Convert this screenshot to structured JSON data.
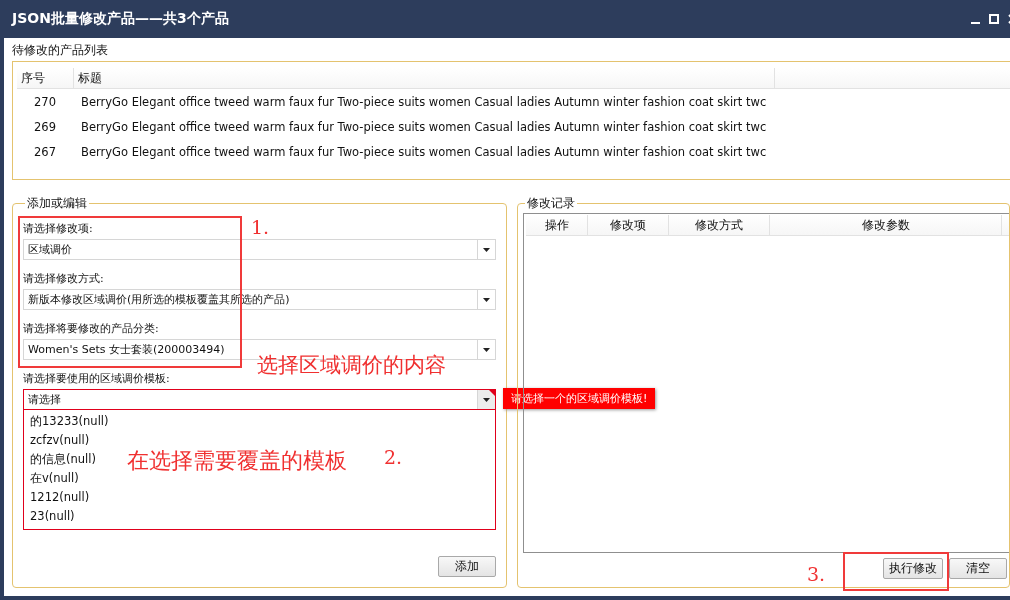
{
  "window": {
    "title": "JSON批量修改产品——共3个产品"
  },
  "product_list": {
    "label": "待修改的产品列表",
    "columns": [
      "序号",
      "标题"
    ],
    "rows": [
      {
        "index": "270",
        "title": "BerryGo Elegant office tweed warm faux fur Two-piece suits women Casual ladies Autumn winter fashion coat skirt twc"
      },
      {
        "index": "269",
        "title": "BerryGo Elegant office tweed warm faux fur Two-piece suits women Casual ladies Autumn winter fashion coat skirt twc"
      },
      {
        "index": "267",
        "title": "BerryGo Elegant office tweed warm faux fur Two-piece suits women Casual ladies Autumn winter fashion coat skirt twc"
      }
    ]
  },
  "edit_group": {
    "title": "添加或编辑",
    "fields": [
      {
        "label": "请选择修改项:",
        "value": "区域调价",
        "error": false,
        "expanded": false
      },
      {
        "label": "请选择修改方式:",
        "value": "新版本修改区域调价(用所选的模板覆盖其所选的产品)",
        "error": false,
        "expanded": false
      },
      {
        "label": "请选择将要修改的产品分类:",
        "value": "Women's Sets 女士套装(200003494)",
        "error": false,
        "expanded": false
      },
      {
        "label": "请选择要使用的区域调价模板:",
        "value": "请选择",
        "error": true,
        "expanded": true,
        "error_tip": "请选择一个的区域调价模板!",
        "options": [
          {
            "label": "的13233(null)",
            "selected": false
          },
          {
            "label": "zcfzv(null)",
            "selected": false
          },
          {
            "label": "的信息(null)",
            "selected": false
          },
          {
            "label": "在v(null)",
            "selected": false
          },
          {
            "label": "1212(null)",
            "selected": false
          },
          {
            "label": "23(null)",
            "selected": false
          }
        ]
      }
    ],
    "add_button": "添加"
  },
  "log_group": {
    "title": "修改记录",
    "columns": [
      "操作",
      "修改项",
      "修改方式",
      "修改参数"
    ],
    "buttons": [
      "执行修改",
      "清空"
    ]
  },
  "annotations": [
    {
      "kind": "box"
    },
    {
      "kind": "text",
      "text": "1."
    },
    {
      "kind": "text",
      "text": "选择区域调价的内容"
    },
    {
      "kind": "text",
      "text": "在选择需要覆盖的模板"
    },
    {
      "kind": "text",
      "text": "2."
    },
    {
      "kind": "text",
      "text": "3."
    },
    {
      "kind": "box"
    }
  ]
}
